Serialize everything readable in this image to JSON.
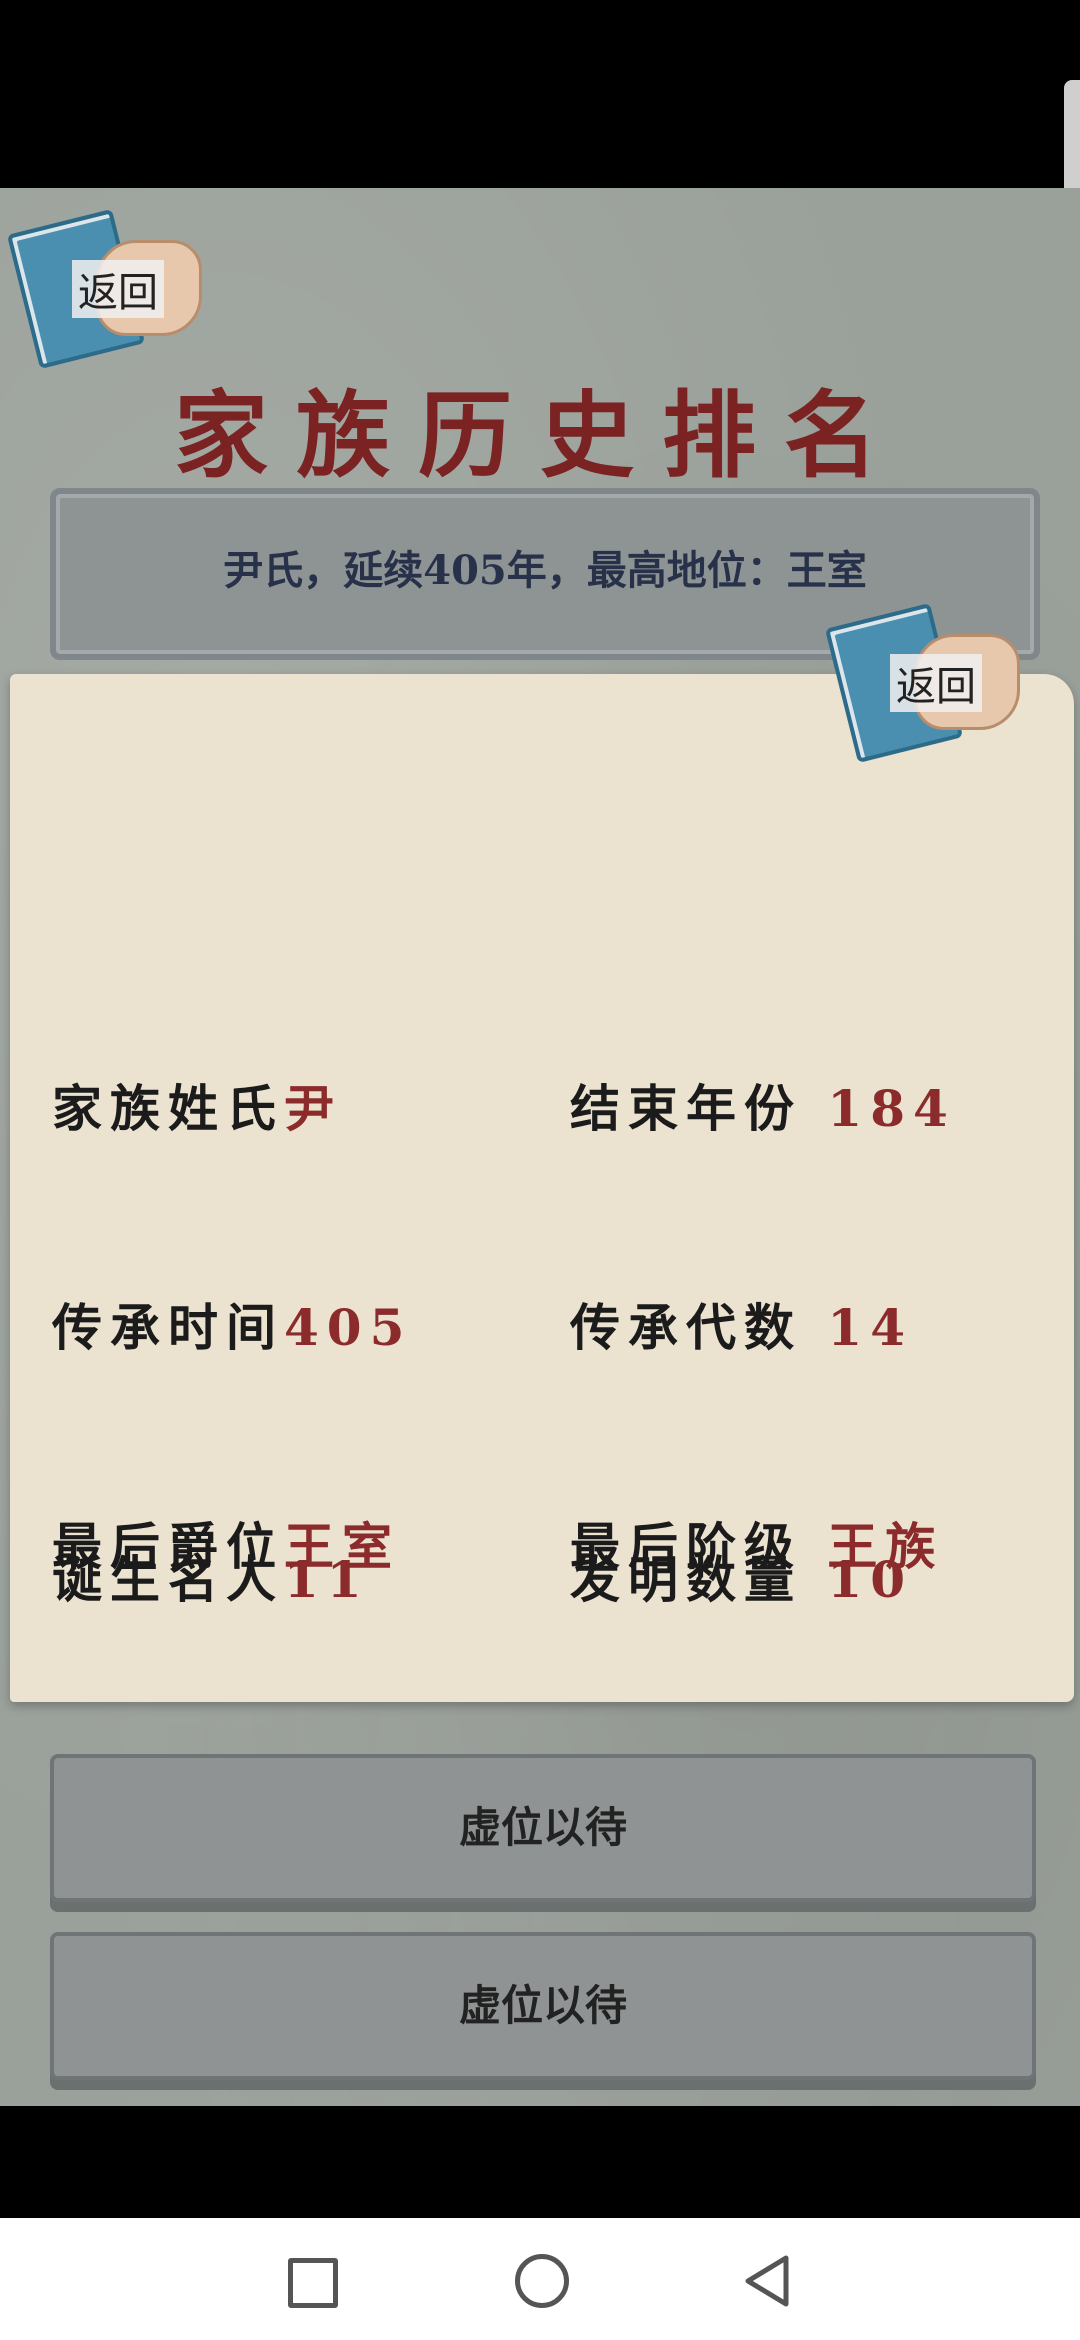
{
  "back_button": {
    "label": "返回"
  },
  "title": "家族历史排名",
  "summary": "尹氏，延续405年，最高地位：王室",
  "detail": {
    "back_label": "返回",
    "fields": [
      {
        "key": "家族姓氏",
        "value": "尹"
      },
      {
        "key": "结束年份",
        "value": "184"
      },
      {
        "key": "传承时间",
        "value": "405"
      },
      {
        "key": "传承代数",
        "value": "14"
      },
      {
        "key": "最后爵位",
        "value": "王室"
      },
      {
        "key": "最后阶级",
        "value": "王族"
      },
      {
        "key": "诞生名人",
        "value": "11"
      },
      {
        "key": "发明数量",
        "value": "10"
      }
    ]
  },
  "slots": [
    {
      "label": "虚位以待"
    },
    {
      "label": "虚位以待"
    }
  ],
  "nav": {
    "icons": [
      "recent-apps-icon",
      "home-icon",
      "back-icon"
    ]
  },
  "colors": {
    "title": "#7b2222",
    "value": "#8b2b2b",
    "summary_text": "#28314a",
    "panel": "#ebe2d0"
  }
}
